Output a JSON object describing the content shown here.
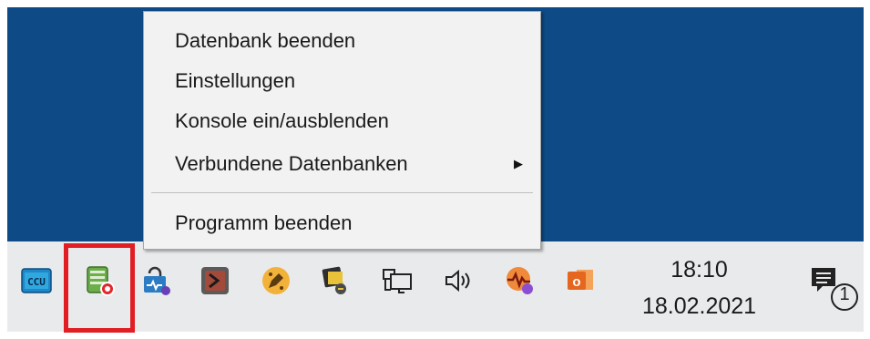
{
  "context_menu": {
    "items": [
      {
        "label": "Datenbank beenden"
      },
      {
        "label": "Einstellungen"
      },
      {
        "label": "Konsole ein/ausblenden"
      },
      {
        "label": "Verbundene Datenbanken",
        "submenu_arrow": "▶"
      },
      {
        "label": "Programm beenden"
      }
    ]
  },
  "tray": {
    "icons": [
      {
        "name": "ccu-icon",
        "text": "CCU"
      },
      {
        "name": "database-server-icon"
      },
      {
        "name": "network-lock-icon"
      },
      {
        "name": "terminal-app-icon"
      },
      {
        "name": "pencil-app-icon"
      },
      {
        "name": "media-app-icon"
      },
      {
        "name": "network-icon"
      },
      {
        "name": "speaker-icon"
      },
      {
        "name": "pulse-monitor-icon"
      },
      {
        "name": "outlook-icon",
        "text": "o"
      }
    ],
    "highlight_color": "#e01e24"
  },
  "clock": {
    "time": "18:10",
    "date": "18.02.2021"
  },
  "notifications": {
    "badge": "1"
  },
  "colors": {
    "desktop": "#0e4a86",
    "taskbar": "#e9eaec",
    "menu_bg": "#f2f2f2"
  }
}
